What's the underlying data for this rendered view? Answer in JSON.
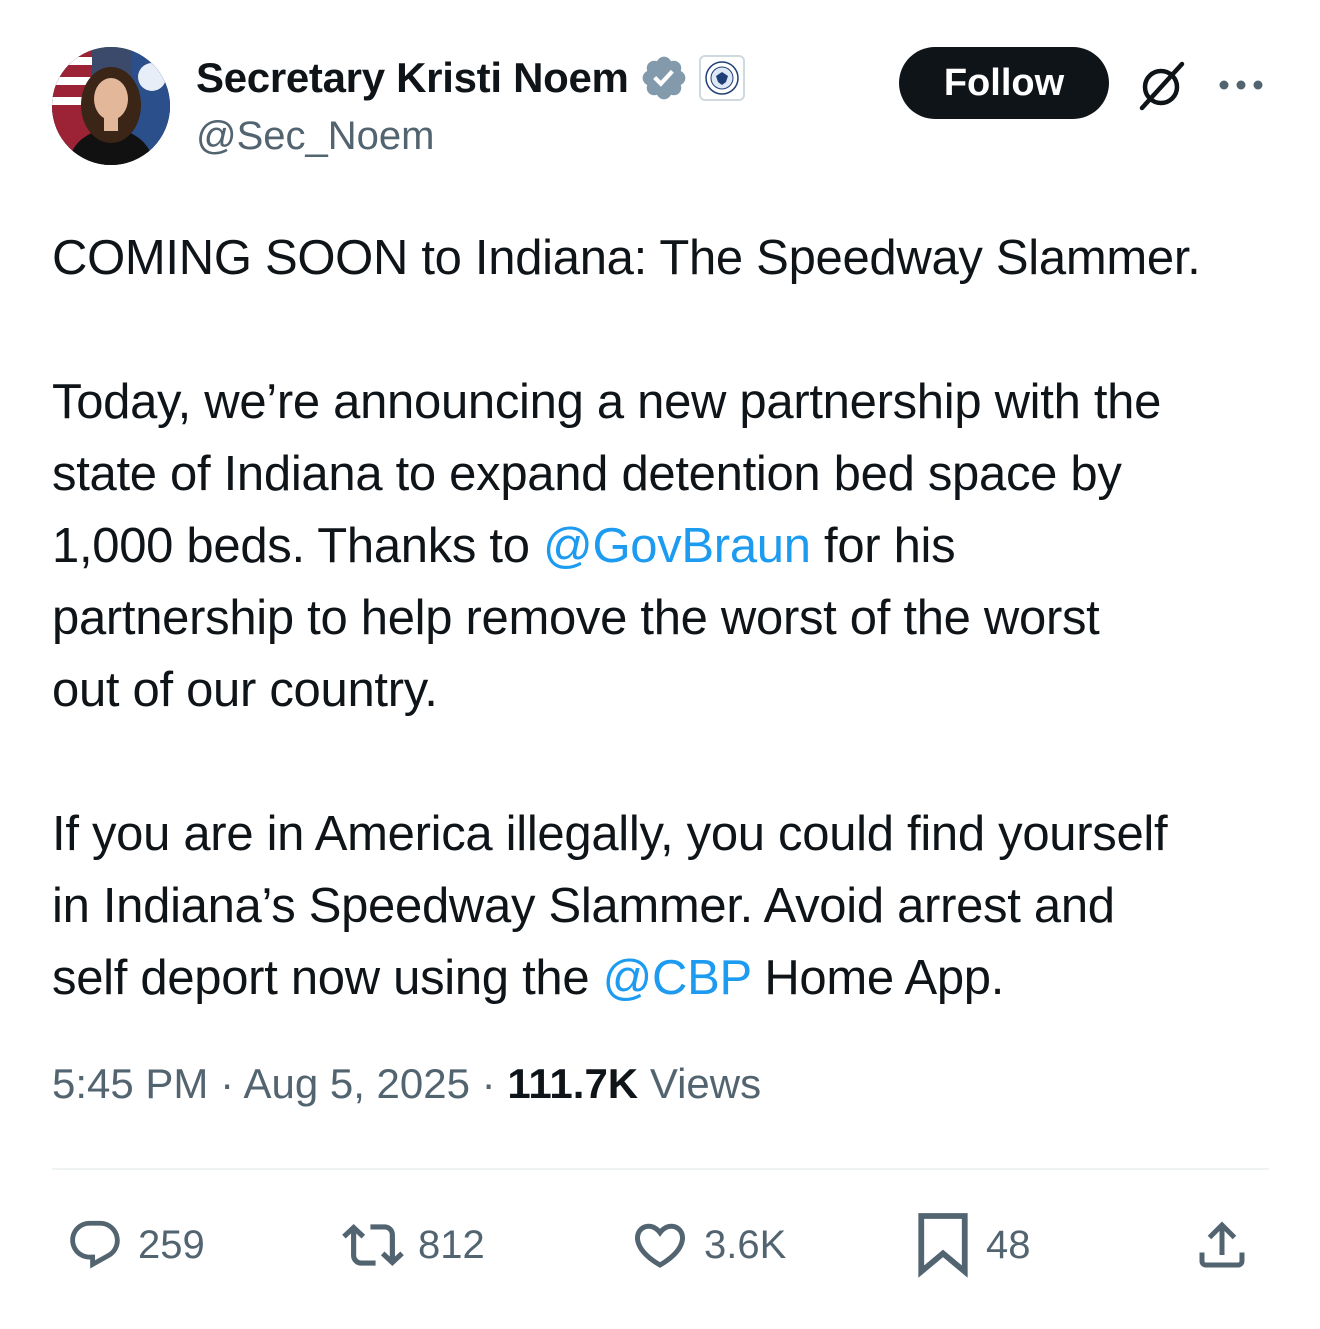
{
  "author": {
    "display_name": "Secretary Kristi Noem",
    "handle": "@Sec_Noem",
    "verified_icon": "verified-badge-icon",
    "affiliate_icon": "dhs-seal-icon"
  },
  "header_actions": {
    "follow_label": "Follow",
    "grok_icon": "grok-icon",
    "more_icon": "more-options-icon"
  },
  "tweet": {
    "lines": [
      "COMING SOON to Indiana: The Speedway Slammer.",
      "Today, we’re announcing a new partnership with the",
      "state of Indiana to expand detention bed space by",
      "1,000 beds. Thanks to ",
      "@GovBraun",
      " for his",
      "partnership to help remove the worst of the worst",
      "out of our country.",
      "If you are in America illegally, you could find yourself",
      "in Indiana’s Speedway Slammer. Avoid arrest and",
      "self deport now using the ",
      "@CBP",
      " Home App."
    ]
  },
  "meta": {
    "time": "5:45 PM",
    "date": "Aug 5, 2025",
    "separator": "·",
    "views_count": "111.7K",
    "views_label": "Views"
  },
  "actions": {
    "replies": "259",
    "reposts": "812",
    "likes": "3.6K",
    "bookmarks": "48"
  },
  "colors": {
    "text": "#0f1419",
    "secondary": "#536471",
    "link": "#1d9bf0",
    "verified": "#829aab",
    "follow_bg": "#0f1419"
  }
}
